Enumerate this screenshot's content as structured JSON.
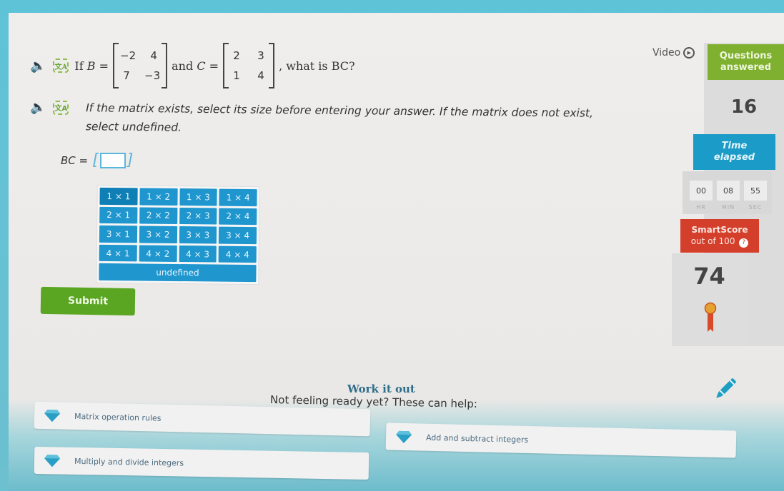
{
  "question": {
    "intro_prefix": "If",
    "b_label": "B =",
    "matrix_b": [
      [
        "−2",
        "4"
      ],
      [
        "7",
        "−3"
      ]
    ],
    "and_label": "and",
    "c_label": "C =",
    "matrix_c": [
      [
        "2",
        "3"
      ],
      [
        "1",
        "4"
      ]
    ],
    "suffix": ", what is BC?",
    "instruction": "If the matrix exists, select its size before entering your answer. If the matrix does not exist, select undefined.",
    "answer_label": "BC =",
    "answer_value": "",
    "icons": {
      "audio": "speaker-icon",
      "translate": "translate-icon"
    }
  },
  "size_options": [
    [
      "1 × 1",
      "1 × 2",
      "1 × 3",
      "1 × 4"
    ],
    [
      "2 × 1",
      "2 × 2",
      "2 × 3",
      "2 × 4"
    ],
    [
      "3 × 1",
      "3 × 2",
      "3 × 3",
      "3 × 4"
    ],
    [
      "4 × 1",
      "4 × 2",
      "4 × 3",
      "4 × 4"
    ]
  ],
  "undefined_label": "undefined",
  "submit_label": "Submit",
  "sidebar": {
    "video_label": "Video",
    "questions_answered_label": [
      "Questions",
      "answered"
    ],
    "questions_answered": "16",
    "time_elapsed_label": [
      "Time",
      "elapsed"
    ],
    "timer": {
      "hr": "00",
      "min": "08",
      "sec": "55"
    },
    "timer_labels": {
      "hr": "HR",
      "min": "MIN",
      "sec": "SEC"
    },
    "smartscore_label": "SmartScore",
    "smartscore_sub": "out of 100",
    "smartscore": "74",
    "colors": {
      "green": "#7fb030",
      "blue": "#1b9bc7",
      "red": "#d43f2b"
    }
  },
  "work_it_out": {
    "title": "Work it out",
    "subtitle": "Not feeling ready yet? These can help:",
    "links": [
      "Matrix operation rules",
      "Add and subtract integers",
      "Multiply and divide integers"
    ]
  }
}
